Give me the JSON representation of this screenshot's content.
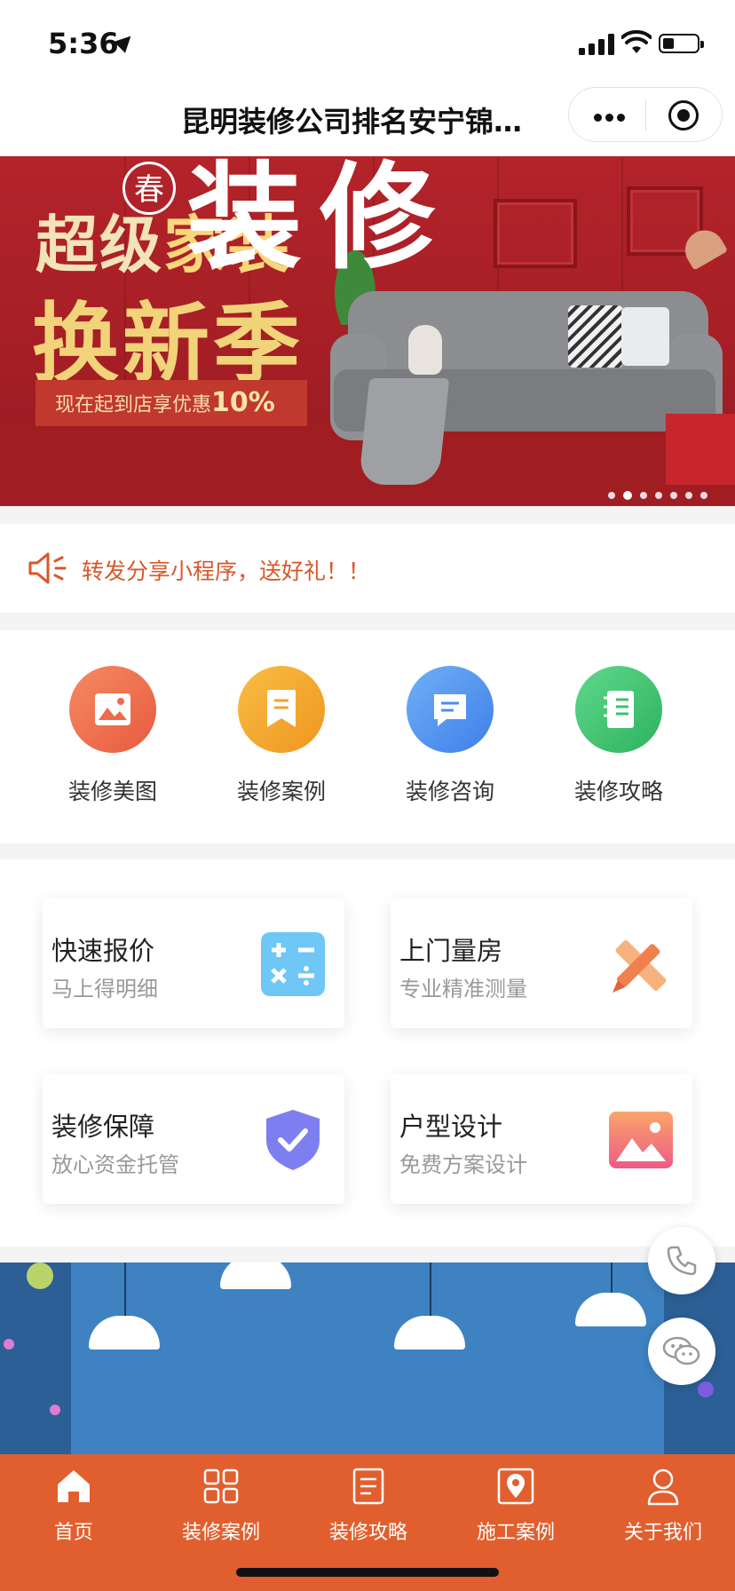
{
  "status_bar": {
    "time": "5:36"
  },
  "nav": {
    "title": "昆明装修公司排名安宁锦…"
  },
  "banner": {
    "title_line1_a": "超级",
    "title_line1_b": "家装",
    "title_line2": "换新季",
    "promo_text": "现在起到店享优惠",
    "promo_value": "10%",
    "slide_count": 7,
    "active_slide": 1
  },
  "notice": {
    "text": "转发分享小程序，送好礼！！"
  },
  "quick_nav": [
    {
      "label": "装修美图",
      "icon": "image-icon",
      "color": "#ee6a4c"
    },
    {
      "label": "装修案例",
      "icon": "bookmark-icon",
      "color": "#f3a12f"
    },
    {
      "label": "装修咨询",
      "icon": "chat-icon",
      "color": "#4a8ff0"
    },
    {
      "label": "装修攻略",
      "icon": "notebook-icon",
      "color": "#3ec16f"
    }
  ],
  "services": [
    {
      "title": "快速报价",
      "subtitle": "马上得明细",
      "icon": "calculator-icon"
    },
    {
      "title": "上门量房",
      "subtitle": "专业精准测量",
      "icon": "ruler-pencil-icon"
    },
    {
      "title": "装修保障",
      "subtitle": "放心资金托管",
      "icon": "shield-check-icon"
    },
    {
      "title": "户型设计",
      "subtitle": "免费方案设计",
      "icon": "picture-icon"
    }
  ],
  "banner2": {
    "badge": "春",
    "headline": "装修"
  },
  "tabbar": [
    {
      "label": "首页",
      "icon": "home-icon"
    },
    {
      "label": "装修案例",
      "icon": "grid-icon"
    },
    {
      "label": "装修攻略",
      "icon": "document-icon"
    },
    {
      "label": "施工案例",
      "icon": "location-icon"
    },
    {
      "label": "关于我们",
      "icon": "user-icon"
    }
  ],
  "colors": {
    "accent": "#e15f2e",
    "banner_red": "#a51e25",
    "notice_text": "#d8572a"
  }
}
